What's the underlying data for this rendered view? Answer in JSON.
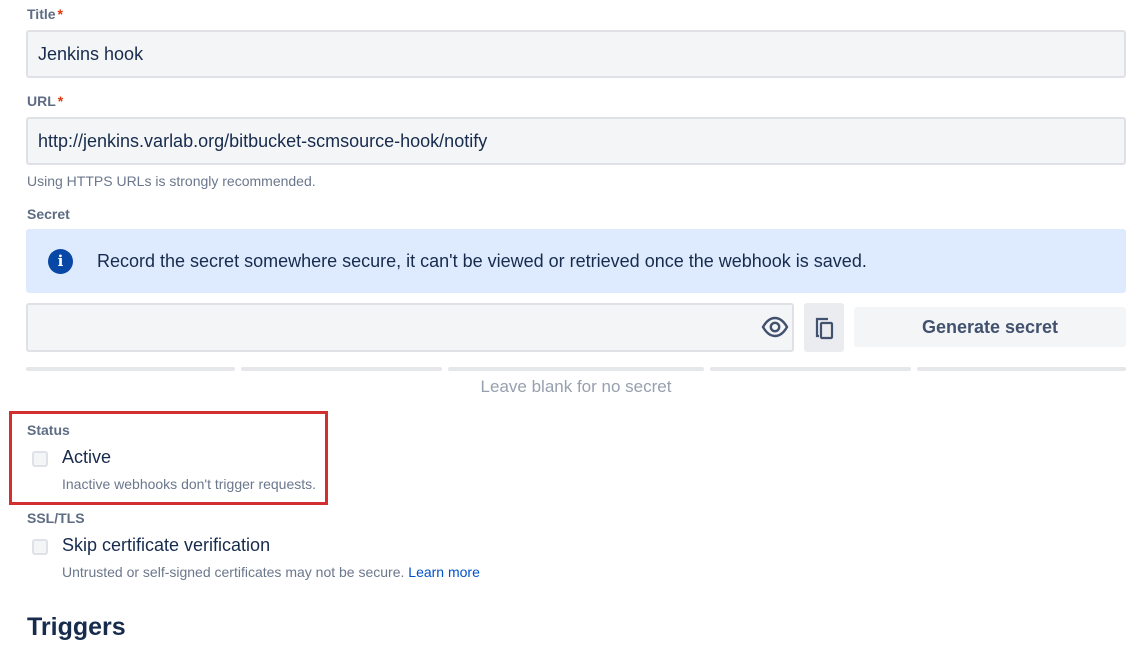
{
  "form": {
    "title_label": "Title",
    "required_mark": "*",
    "title_value": "Jenkins hook",
    "url_label": "URL",
    "url_value": "http://jenkins.varlab.org/bitbucket-scmsource-hook/notify",
    "url_help": "Using HTTPS URLs is strongly recommended.",
    "secret_label": "Secret",
    "secret_info": "Record the secret somewhere secure, it can't be viewed or retrieved once the webhook is saved.",
    "secret_value": "",
    "generate_secret_label": "Generate secret",
    "secret_strength_text": "Leave blank for no secret",
    "status_label": "Status",
    "active_label": "Active",
    "active_checked": false,
    "active_help": "Inactive webhooks don't trigger requests.",
    "ssl_label": "SSL/TLS",
    "skip_cert_label": "Skip certificate verification",
    "skip_cert_checked": false,
    "skip_cert_help": "Untrusted or self-signed certificates may not be secure.",
    "learn_more": "Learn more",
    "triggers_heading": "Triggers"
  },
  "icons": {
    "info": "info-icon",
    "eye": "eye-icon",
    "copy": "copy-icon"
  },
  "colors": {
    "accent": "#0052cc",
    "info_bg": "#deebff",
    "info_icon": "#0747a6",
    "required": "#de350b",
    "highlight": "#d32f2f"
  }
}
